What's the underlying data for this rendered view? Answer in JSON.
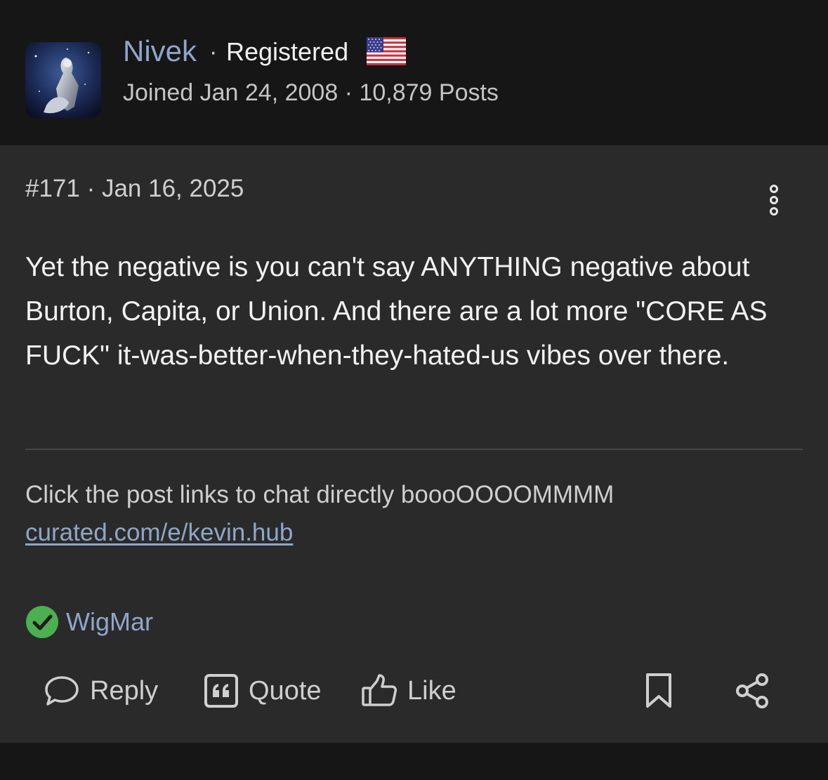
{
  "author": {
    "name": "Nivek",
    "role": "Registered",
    "separator": "·",
    "flag_icon": "us-flag-icon",
    "meta": "Joined Jan 24, 2008 · 10,879 Posts"
  },
  "post": {
    "meta": "#171 · Jan 16, 2025",
    "body": "Yet the negative is you can't say ANYTHING negative about Burton, Capita, or Union. And there are a lot more \"CORE AS FUCK\" it-was-better-when-they-hated-us vibes over there.",
    "signature": "Click the post links to chat directly boooOOOOMMMM",
    "signature_link": "curated.com/e/kevin.hub",
    "reacted_by": "WigMar"
  },
  "actions": {
    "reply": "Reply",
    "quote": "Quote",
    "like": "Like"
  },
  "colors": {
    "background": "#161616",
    "post_background": "#2a2a2a",
    "link": "#8fa6c9",
    "check_green": "#4caf50"
  }
}
